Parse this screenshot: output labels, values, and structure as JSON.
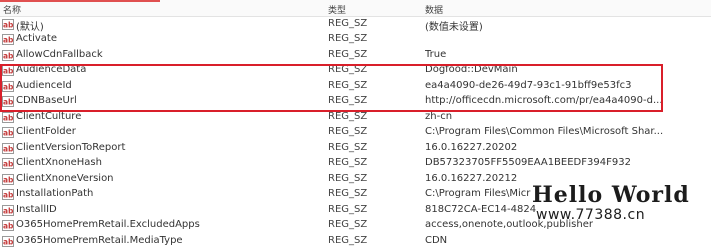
{
  "colors": {
    "highlight": "#d91f2a",
    "icon_red": "#c43b3b",
    "header_accent": "#e05050"
  },
  "header": {
    "name": "名称",
    "type": "类型",
    "data": "数据"
  },
  "rows": [
    {
      "name": "(默认)",
      "type": "REG_SZ",
      "data": "(数值未设置)",
      "icon": "reg-string-icon"
    },
    {
      "name": "Activate",
      "type": "REG_SZ",
      "data": "",
      "icon": "reg-string-icon"
    },
    {
      "name": "AllowCdnFallback",
      "type": "REG_SZ",
      "data": "True",
      "icon": "reg-string-icon"
    },
    {
      "name": "AudienceData",
      "type": "REG_SZ",
      "data": "Dogfood::DevMain",
      "icon": "reg-string-icon"
    },
    {
      "name": "AudienceId",
      "type": "REG_SZ",
      "data": "ea4a4090-de26-49d7-93c1-91bff9e53fc3",
      "icon": "reg-string-icon"
    },
    {
      "name": "CDNBaseUrl",
      "type": "REG_SZ",
      "data": "http://officecdn.microsoft.com/pr/ea4a4090-d...",
      "icon": "reg-string-icon"
    },
    {
      "name": "ClientCulture",
      "type": "REG_SZ",
      "data": "zh-cn",
      "icon": "reg-string-icon"
    },
    {
      "name": "ClientFolder",
      "type": "REG_SZ",
      "data": "C:\\Program Files\\Common Files\\Microsoft Shar...",
      "icon": "reg-string-icon"
    },
    {
      "name": "ClientVersionToReport",
      "type": "REG_SZ",
      "data": "16.0.16227.20202",
      "icon": "reg-string-icon"
    },
    {
      "name": "ClientXnoneHash",
      "type": "REG_SZ",
      "data": "DB57323705FF5509EAA1BEEDF394F932",
      "icon": "reg-string-icon"
    },
    {
      "name": "ClientXnoneVersion",
      "type": "REG_SZ",
      "data": "16.0.16227.20212",
      "icon": "reg-string-icon"
    },
    {
      "name": "InstallationPath",
      "type": "REG_SZ",
      "data": "C:\\Program Files\\Micr",
      "icon": "reg-string-icon"
    },
    {
      "name": "InstallID",
      "type": "REG_SZ",
      "data": "818C72CA-EC14-4824",
      "icon": "reg-string-icon"
    },
    {
      "name": "O365HomePremRetail.ExcludedApps",
      "type": "REG_SZ",
      "data": "access,onenote,outlook,publisher",
      "icon": "reg-string-icon"
    },
    {
      "name": "O365HomePremRetail.MediaType",
      "type": "REG_SZ",
      "data": "CDN",
      "icon": "reg-string-icon"
    }
  ],
  "watermark": {
    "title": "Hello World",
    "url": "www.77388.cn"
  }
}
